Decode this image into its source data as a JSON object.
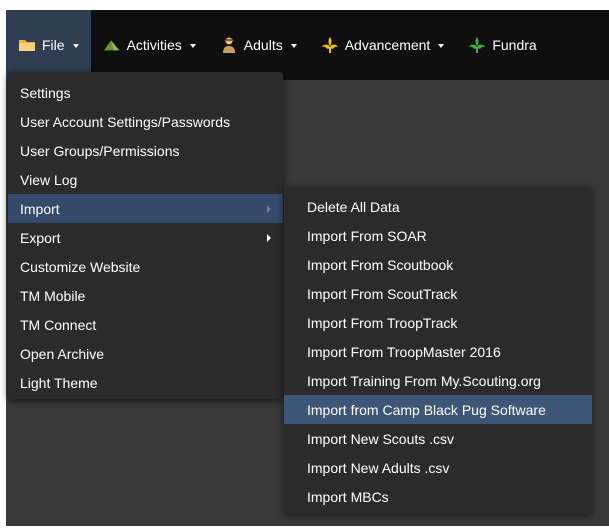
{
  "navbar": {
    "items": [
      {
        "label": "File",
        "icon": "folder-icon"
      },
      {
        "label": "Activities",
        "icon": "tent-icon"
      },
      {
        "label": "Adults",
        "icon": "scout-leader-icon"
      },
      {
        "label": "Advancement",
        "icon": "fleur-de-lis-icon"
      },
      {
        "label": "Fundra",
        "icon": "fleur-de-lis-green-icon"
      }
    ]
  },
  "file_menu": {
    "items": [
      {
        "label": "Settings"
      },
      {
        "label": "User Account Settings/Passwords"
      },
      {
        "label": "User Groups/Permissions"
      },
      {
        "label": "View Log"
      },
      {
        "label": "Import"
      },
      {
        "label": "Export"
      },
      {
        "label": "Customize Website"
      },
      {
        "label": "TM Mobile"
      },
      {
        "label": "TM Connect"
      },
      {
        "label": "Open Archive"
      },
      {
        "label": "Light Theme"
      }
    ]
  },
  "import_menu": {
    "items": [
      {
        "label": "Delete All Data"
      },
      {
        "label": "Import From SOAR"
      },
      {
        "label": "Import From Scoutbook"
      },
      {
        "label": "Import From ScoutTrack"
      },
      {
        "label": "Import From TroopTrack"
      },
      {
        "label": "Import From TroopMaster 2016"
      },
      {
        "label": "Import Training From My.Scouting.org"
      },
      {
        "label": "Import from Camp Black Pug Software"
      },
      {
        "label": "Import New Scouts .csv"
      },
      {
        "label": "Import New Adults .csv"
      },
      {
        "label": "Import MBCs"
      }
    ]
  },
  "colors": {
    "navbar_bg": "#0f0f0f",
    "menu_bg": "#2b2b2b",
    "highlight": "#35496a"
  }
}
